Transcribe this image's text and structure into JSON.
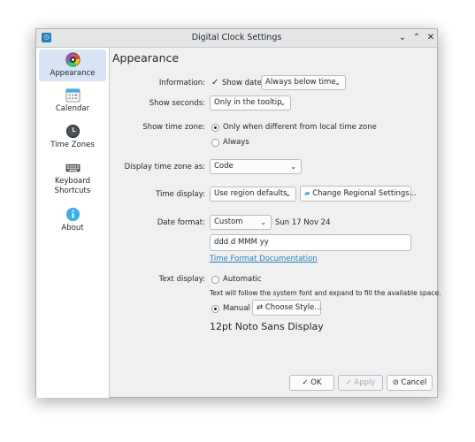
{
  "window": {
    "title": "Digital Clock Settings",
    "app_icon": "clock-settings-icon",
    "controls": {
      "minimize": "⌄",
      "maximize": "⌃",
      "close": "✕"
    }
  },
  "sidebar": {
    "items": [
      {
        "label": "Appearance",
        "icon": "appearance-palette-icon",
        "active": true
      },
      {
        "label": "Calendar",
        "icon": "calendar-icon",
        "active": false
      },
      {
        "label": "Time Zones",
        "icon": "clock-icon",
        "active": false
      },
      {
        "label": "Keyboard\nShortcuts",
        "line1": "Keyboard",
        "line2": "Shortcuts",
        "icon": "keyboard-icon",
        "active": false
      },
      {
        "label": "About",
        "icon": "info-icon",
        "active": false
      }
    ]
  },
  "page": {
    "title": "Appearance",
    "information": {
      "label": "Information:",
      "show_date_label": "Show date",
      "show_date_checked": true,
      "date_position": "Always below time"
    },
    "seconds": {
      "label": "Show seconds:",
      "value": "Only in the tooltip"
    },
    "timezone": {
      "label": "Show time zone:",
      "option_1": "Only when different from local time zone",
      "option_2": "Always",
      "selected": 1
    },
    "display_tz_as": {
      "label": "Display time zone as:",
      "value": "Code"
    },
    "time_display": {
      "label": "Time display:",
      "value": "Use region defaults",
      "regional_button": "Change Regional Settings..."
    },
    "date_format": {
      "label": "Date format:",
      "value": "Custom",
      "preview": "Sun 17 Nov 24",
      "custom_format": "ddd d MMM yy",
      "doc_link": "Time Format Documentation"
    },
    "text_display": {
      "label": "Text display:",
      "automatic_label": "Automatic",
      "automatic_hint": "Text will follow the system font and expand to fill the available space.",
      "manual_label": "Manual",
      "choose_style_button": "Choose Style...",
      "font_preview": "12pt Noto Sans Display",
      "selected": "manual"
    }
  },
  "footer": {
    "ok_label": "OK",
    "apply_label": "Apply",
    "cancel_label": "Cancel"
  },
  "colors": {
    "accent": "#2980b9",
    "selection": "#d6e4f5",
    "window_bg": "#eff0f1"
  }
}
